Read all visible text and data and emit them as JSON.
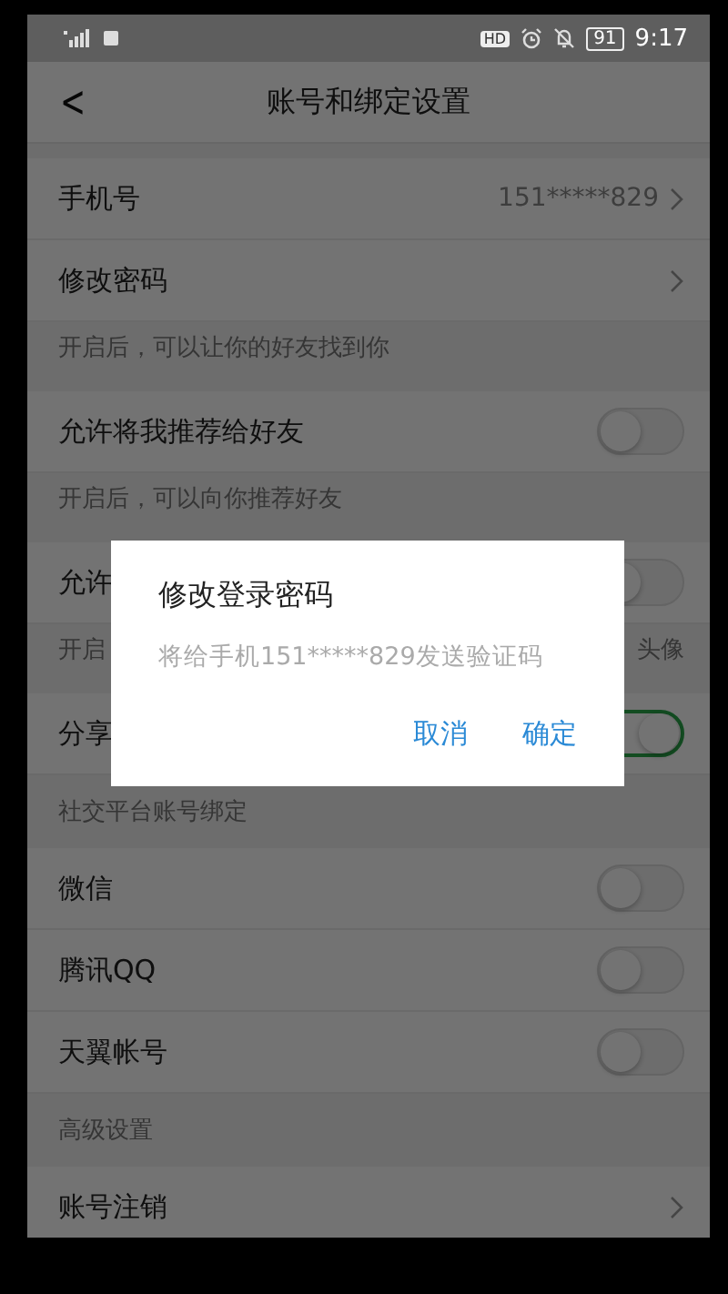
{
  "status_bar": {
    "hd_badge": "HD",
    "battery": "91",
    "time": "9:17"
  },
  "header": {
    "back": "<",
    "title": "账号和绑定设置"
  },
  "items": [
    {
      "kind": "link",
      "label": "手机号",
      "value": "151*****829"
    },
    {
      "kind": "link",
      "label": "修改密码"
    },
    {
      "kind": "note",
      "label": "开启后，可以让你的好友找到你"
    },
    {
      "kind": "toggle",
      "label": "允许将我推荐给好友",
      "on": false
    },
    {
      "kind": "note",
      "label": "开启后，可以向你推荐好友"
    },
    {
      "kind": "toggle",
      "label": "允许",
      "on": false
    },
    {
      "kind": "note",
      "label": "开启",
      "value": "头像"
    },
    {
      "kind": "toggle",
      "label": "分享",
      "on": true
    },
    {
      "kind": "section",
      "label": "社交平台账号绑定"
    },
    {
      "kind": "toggle",
      "label": "微信",
      "on": false
    },
    {
      "kind": "toggle",
      "label": "腾讯QQ",
      "on": false
    },
    {
      "kind": "toggle",
      "label": "天翼帐号",
      "on": false
    },
    {
      "kind": "section",
      "label": "高级设置"
    },
    {
      "kind": "link",
      "label": "账号注销"
    }
  ],
  "dialog": {
    "title": "修改登录密码",
    "message": "将给手机151*****829发送验证码",
    "buttons": [
      "取消",
      "确定"
    ]
  }
}
